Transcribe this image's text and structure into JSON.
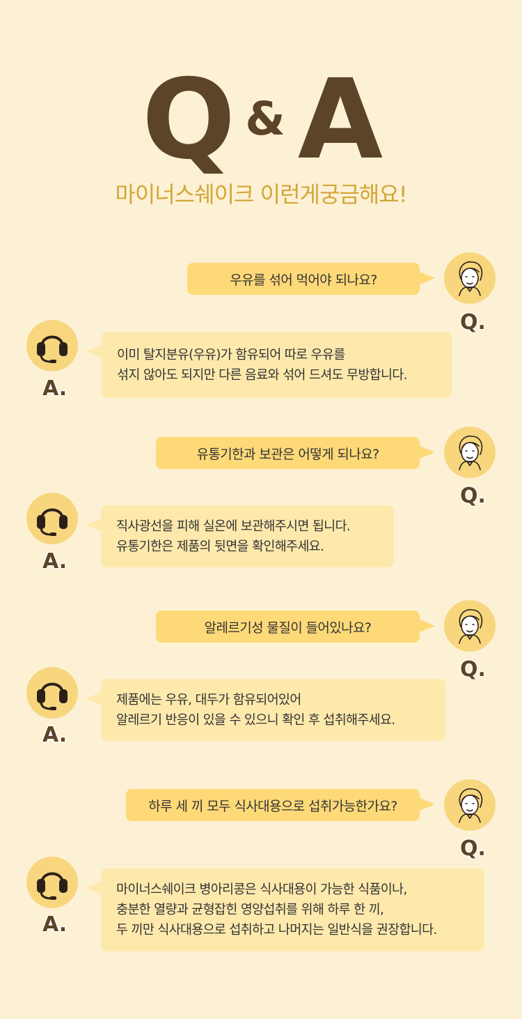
{
  "header": {
    "q": "Q",
    "amp": "&",
    "a": "A",
    "subtitle": "마이너스쉐이크 이런게궁금해요!"
  },
  "labels": {
    "q": "Q.",
    "a": "A."
  },
  "qa": [
    {
      "question": "우유를 섞어 먹어야 되나요?",
      "answer": [
        "이미 탈지분유(우유)가 함유되어 따로 우유를",
        "섞지 않아도 되지만 다른 음료와 섞어 드셔도 무방합니다."
      ]
    },
    {
      "question": "유통기한과 보관은 어떻게 되나요?",
      "answer": [
        "직사광선을 피해 실온에 보관해주시면 됩니다.",
        "유통기한은 제품의 뒷면을 확인해주세요."
      ]
    },
    {
      "question": "알레르기성 물질이 들어있나요?",
      "answer": [
        "제품에는 우유, 대두가 함유되어있어",
        "알레르기 반응이 있을 수 있으니 확인 후 섭취해주세요."
      ]
    },
    {
      "question": "하루 세 끼 모두 식사대용으로 섭취가능한가요?",
      "answer": [
        "마이너스쉐이크 병아리콩은 식사대용이 가능한 식품이나,",
        "충분한 열량과 균형잡힌 영양섭취를 위해 하루 한 끼,",
        "두 끼만 식사대용으로 섭취하고 나머지는 일반식을 권장합니다."
      ]
    }
  ],
  "icons": {
    "question_avatar": "woman-avatar-icon",
    "answer_avatar": "headset-icon"
  },
  "colors": {
    "background": "#fdf1d5",
    "question_bubble": "#fed978",
    "answer_bubble": "#fee9ad",
    "title": "#5c4428",
    "subtitle": "#d2a638",
    "avatar": "#f7d67e"
  }
}
